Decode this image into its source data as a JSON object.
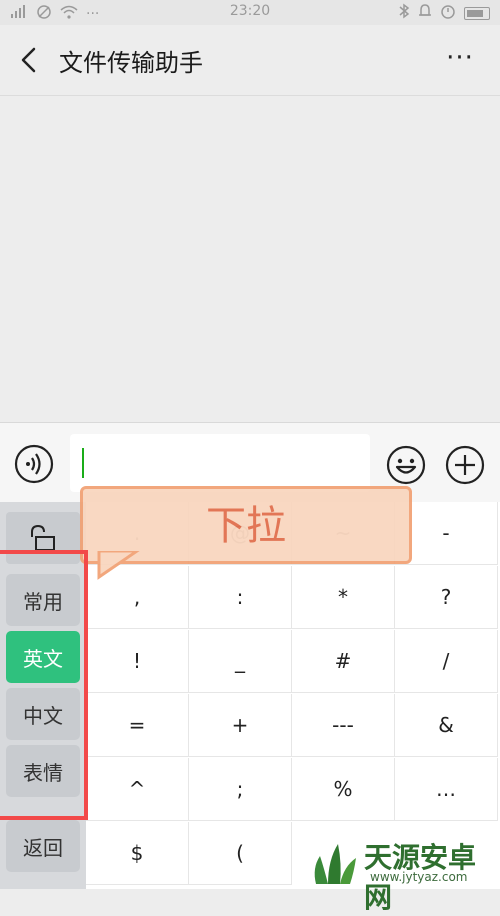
{
  "status_bar": {
    "time": "23:20",
    "left_icons": [
      "signal-icon",
      "no-sim-icon",
      "wifi-icon",
      "more-dots-icon"
    ],
    "right_icons": [
      "bluetooth-icon",
      "bell-icon",
      "alarm-icon",
      "battery-icon"
    ]
  },
  "header": {
    "title": "文件传输助手",
    "more_label": "···"
  },
  "input_bar": {
    "text_value": ""
  },
  "keyboard": {
    "side": [
      "常用",
      "英文",
      "中文",
      "表情",
      "返回"
    ],
    "active_side": "英文",
    "top_row": [
      ".",
      "@",
      "~",
      "-"
    ],
    "rows": [
      [
        ",",
        ":",
        "*",
        "?"
      ],
      [
        "!",
        "_",
        "#",
        "/"
      ],
      [
        "=",
        "+",
        "---",
        "&"
      ],
      [
        "^",
        ";",
        "%",
        "…"
      ],
      [
        "$",
        "(",
        "",
        ""
      ]
    ]
  },
  "annotation": {
    "bubble_text": "下拉"
  },
  "watermark": {
    "title": "天源安卓网",
    "url": "www.jytyaz.com"
  },
  "colors": {
    "accent": "#2fc17e",
    "highlight_box": "#f24949",
    "bubble_fill": "#f9d5bd",
    "bubble_text": "#e06b48"
  }
}
